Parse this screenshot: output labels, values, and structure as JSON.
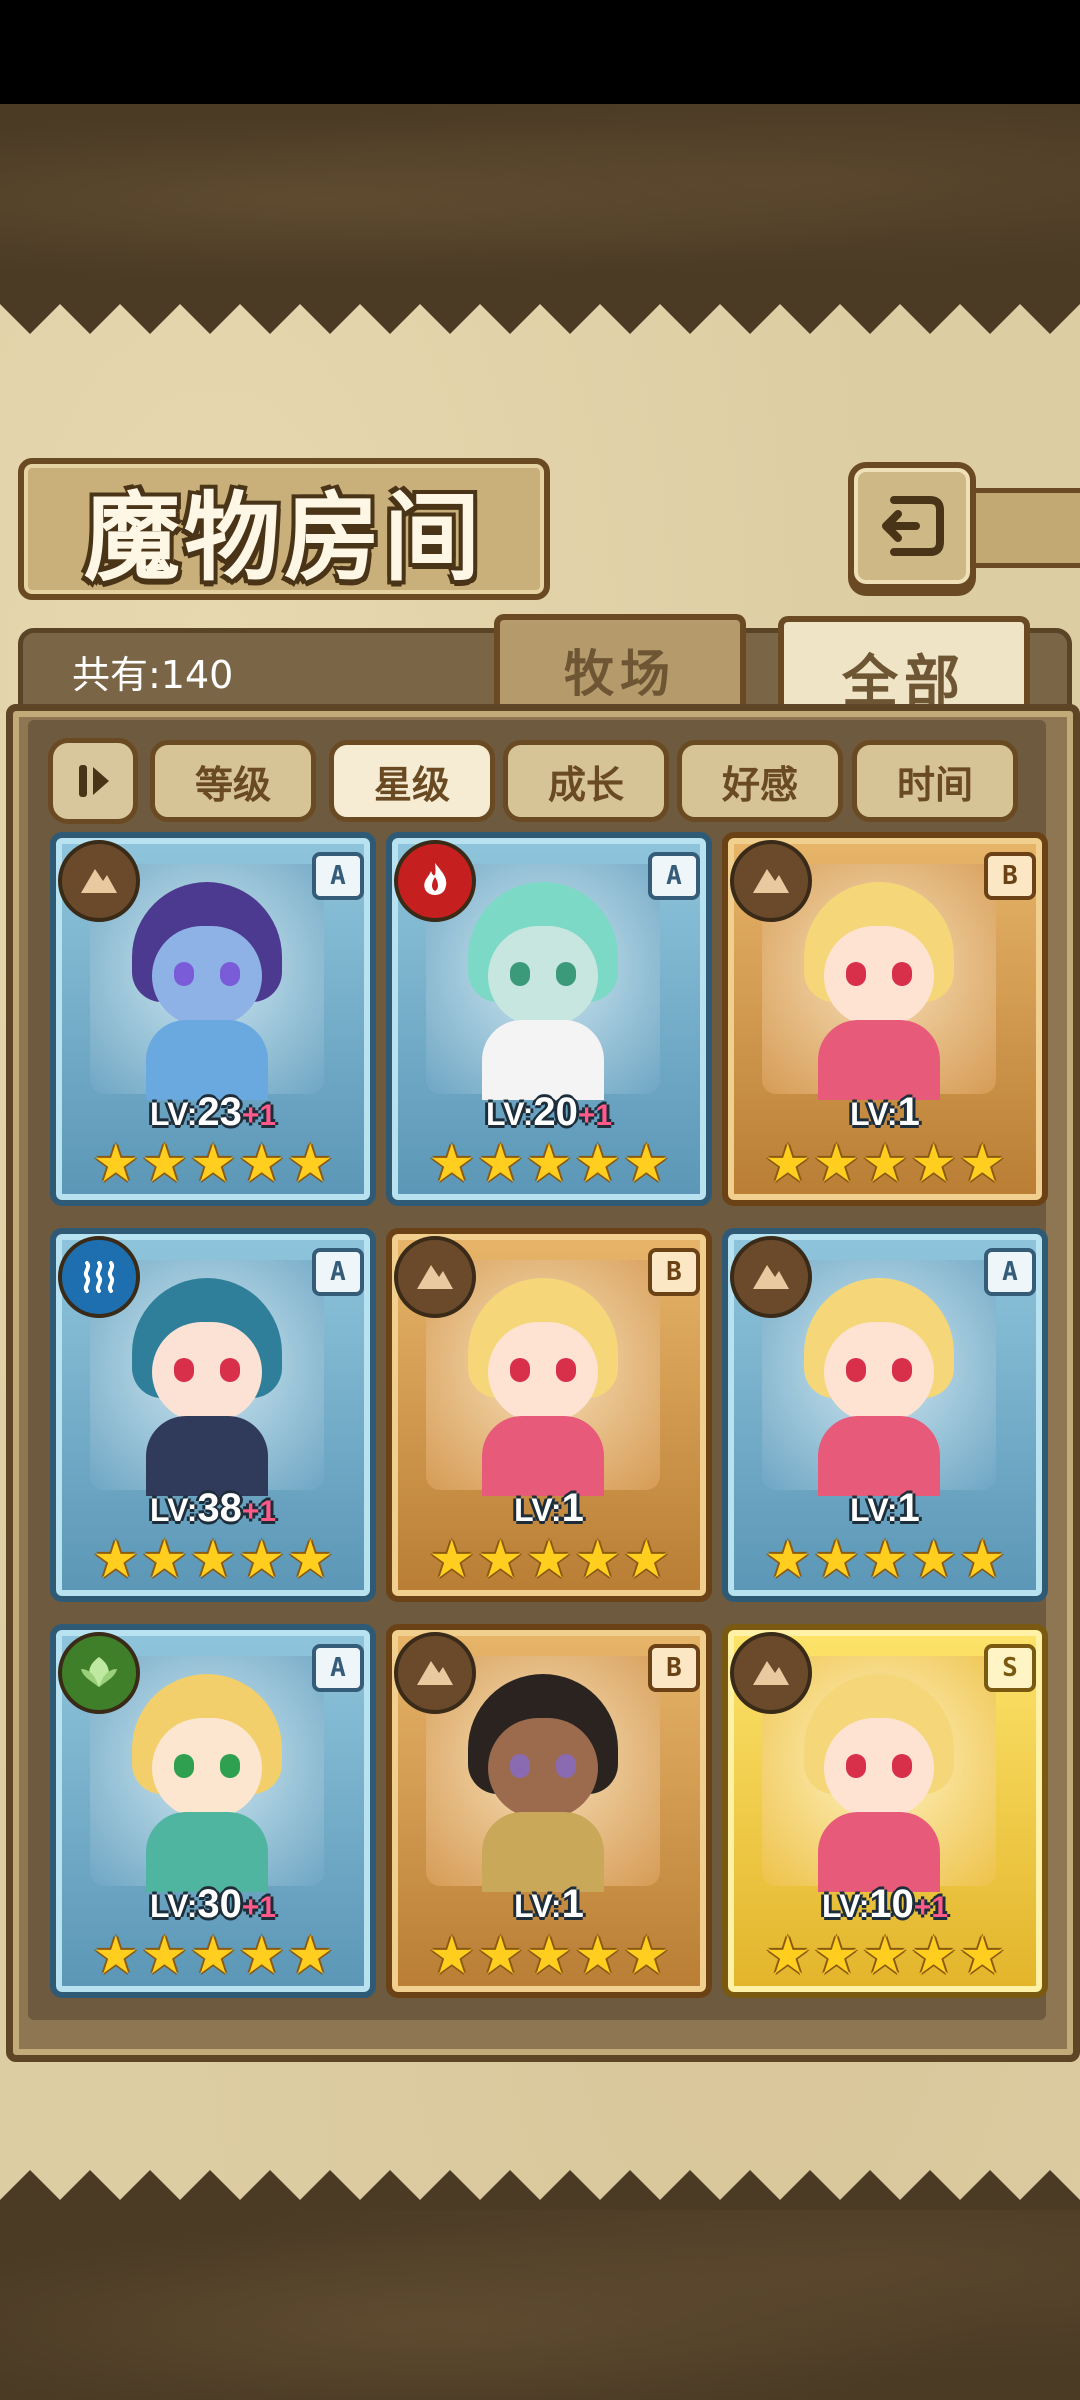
{
  "header": {
    "title": "魔物房间",
    "back_icon": "back-arrow-icon"
  },
  "inventory": {
    "count_label": "共有:140"
  },
  "tabs": [
    {
      "label": "牧场",
      "active": false
    },
    {
      "label": "全部",
      "active": true
    }
  ],
  "sort": {
    "toggle_icon": "sort-order-toggle-icon",
    "buttons": [
      {
        "label": "等级",
        "active": false
      },
      {
        "label": "星级",
        "active": true
      },
      {
        "label": "成长",
        "active": false
      },
      {
        "label": "好感",
        "active": false
      },
      {
        "label": "时间",
        "active": false
      }
    ]
  },
  "colors": {
    "frame_blue": "#2e5a76",
    "frame_bronze": "#6b4216",
    "frame_gold": "#7a5a10",
    "level_plus": "#ff5a8a",
    "star": "#ffce1f"
  },
  "monsters": [
    {
      "element": "earth",
      "rank": "A",
      "lv_prefix": "LV:",
      "level": "23",
      "plus": "+1",
      "stars": 5,
      "frame": "blue"
    },
    {
      "element": "fire",
      "rank": "A",
      "lv_prefix": "LV:",
      "level": "20",
      "plus": "+1",
      "stars": 5,
      "frame": "blue"
    },
    {
      "element": "earth",
      "rank": "B",
      "lv_prefix": "LV:",
      "level": "1",
      "plus": "",
      "stars": 5,
      "frame": "bronze"
    },
    {
      "element": "water",
      "rank": "A",
      "lv_prefix": "LV:",
      "level": "38",
      "plus": "+1",
      "stars": 5,
      "frame": "blue"
    },
    {
      "element": "earth",
      "rank": "B",
      "lv_prefix": "LV:",
      "level": "1",
      "plus": "",
      "stars": 5,
      "frame": "bronze"
    },
    {
      "element": "earth",
      "rank": "A",
      "lv_prefix": "LV:",
      "level": "1",
      "plus": "",
      "stars": 5,
      "frame": "blue"
    },
    {
      "element": "wind",
      "rank": "A",
      "lv_prefix": "LV:",
      "level": "30",
      "plus": "+1",
      "stars": 5,
      "frame": "blue"
    },
    {
      "element": "earth",
      "rank": "B",
      "lv_prefix": "LV:",
      "level": "1",
      "plus": "",
      "stars": 5,
      "frame": "bronze"
    },
    {
      "element": "earth",
      "rank": "S",
      "lv_prefix": "LV:",
      "level": "10",
      "plus": "+1",
      "stars": 5,
      "frame": "gold"
    }
  ]
}
